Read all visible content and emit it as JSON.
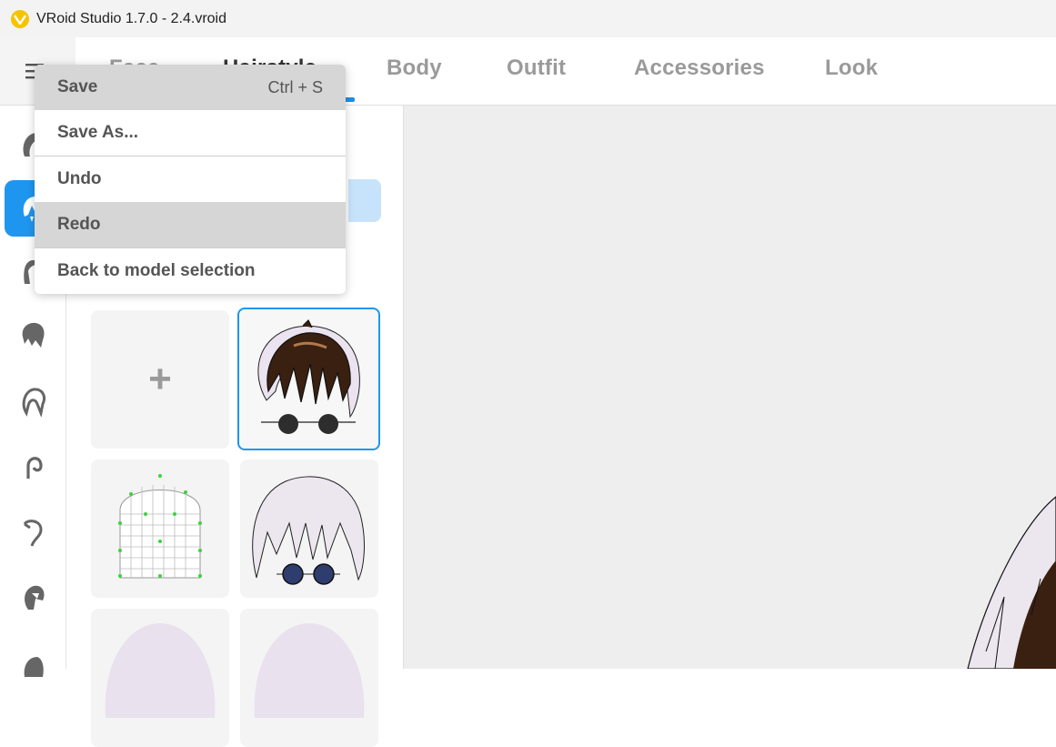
{
  "window": {
    "title": "VRoid Studio 1.7.0 - 2.4.vroid"
  },
  "tabs": [
    {
      "label": "Face"
    },
    {
      "label": "Hairstyle"
    },
    {
      "label": "Body"
    },
    {
      "label": "Outfit"
    },
    {
      "label": "Accessories"
    },
    {
      "label": "Look"
    }
  ],
  "menu": {
    "items": [
      {
        "label": "Save",
        "shortcut": "Ctrl + S"
      },
      {
        "label": "Save As..."
      },
      {
        "label": "Undo"
      },
      {
        "label": "Redo"
      },
      {
        "label": "Back to model selection"
      }
    ]
  },
  "rail": {
    "icons": [
      "bangs-icon",
      "front-hair-icon",
      "side-hair-icon",
      "back-hair-icon",
      "ahoge-icon",
      "hair-ear-icon",
      "hair-curl-icon",
      "hair-ornament-icon",
      "hair-extra-icon"
    ]
  },
  "panel": {
    "add_label": "+",
    "tiles": [
      "new-hair",
      "hair-brown-sunglasses",
      "hair-guide-mesh",
      "hair-white-sunglasses",
      "hair-white-1",
      "hair-white-2"
    ]
  },
  "colors": {
    "accent": "#1e96f0",
    "brand": "#f5c400"
  }
}
